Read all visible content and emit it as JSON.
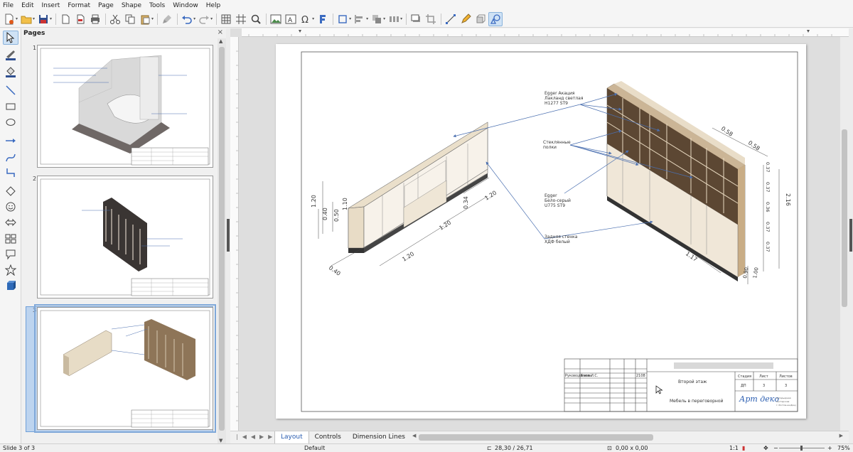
{
  "menu": [
    "File",
    "Edit",
    "Insert",
    "Format",
    "Page",
    "Shape",
    "Tools",
    "Window",
    "Help"
  ],
  "pages_panel": {
    "title": "Pages",
    "close": "×",
    "thumbnails": [
      {
        "number": "1"
      },
      {
        "number": "2"
      },
      {
        "number": "3"
      }
    ]
  },
  "tabs": [
    "Layout",
    "Controls",
    "Dimension Lines"
  ],
  "status": {
    "slide": "Slide 3 of 3",
    "layout": "Default",
    "position": "28,30 / 26,71",
    "size": "0,00 x 0,00",
    "scale": "1:1",
    "zoom": "75%"
  },
  "drawing": {
    "labels": {
      "egger_acacia": [
        "Egger Акация",
        "Лакланд светлая",
        "H1277 ST9"
      ],
      "shelves": [
        "Стеклянные",
        "полки"
      ],
      "egger_grey": [
        "Egger",
        "Бело-серый",
        "U775 ST9"
      ],
      "back_panel": [
        "Задняя стенка",
        "ХДФ белый"
      ]
    },
    "dims_left": [
      "1.20",
      "0.40",
      "1.20",
      "1.20",
      "1.20",
      "0.40",
      "0.50",
      "0.34",
      "1.10"
    ],
    "dims_right": [
      "0.58",
      "0.58",
      "2.16",
      "0.37",
      "0.37",
      "0.36",
      "0.37",
      "0.37",
      "1.17",
      "0.90",
      "1.00"
    ],
    "title_block": {
      "row_label": "Руководитель",
      "row_name": "Баев И.С.",
      "row_date": "2108",
      "floor": "Второй этаж",
      "title": "Мебель в переговорной",
      "stage_h": "Стадия",
      "sheet_h": "Лист",
      "sheets_h": "Листов",
      "stage_v": "ДП",
      "sheet_v": "3",
      "sheets_v": "3",
      "logo": "Арт деко",
      "logo_sub": [
        "интерьерная",
        "мастерская",
        "г. Ростов-на-Дону"
      ]
    }
  },
  "colors": {
    "accent": "#2a5db0",
    "selection": "#bdd4ef",
    "leader": "#4a6fb0"
  }
}
